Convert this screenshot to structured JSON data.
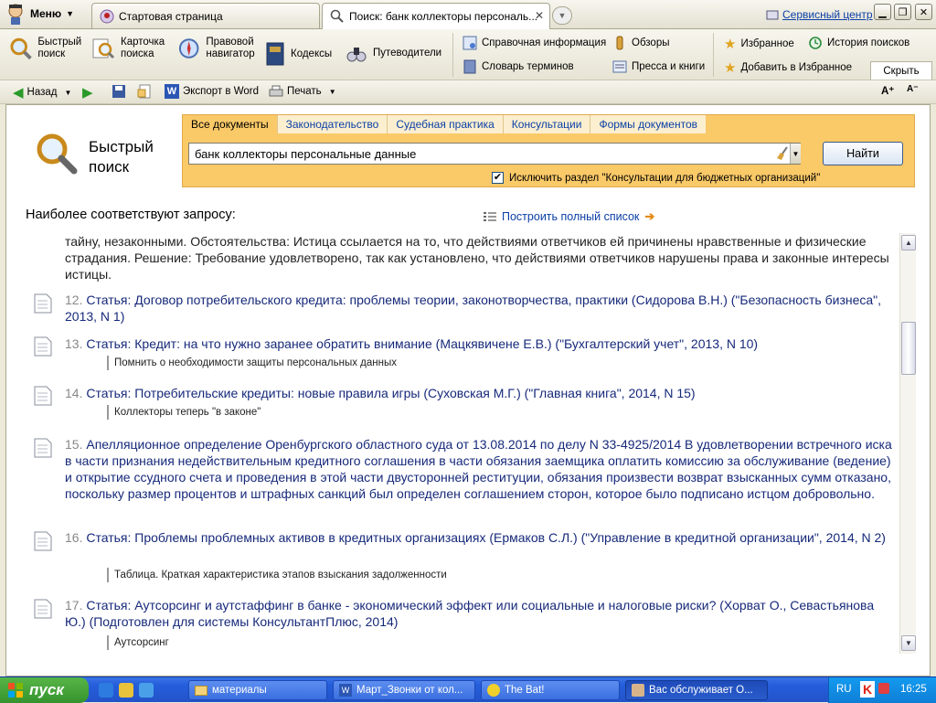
{
  "tabbar": {
    "menu_label": "Меню",
    "tabs": [
      {
        "label": "Стартовая страница"
      },
      {
        "label": "Поиск: банк коллекторы персональ..."
      }
    ],
    "service_link": "Сервисный центр"
  },
  "toolbar": {
    "quick_search": "Быстрый поиск",
    "search_card": "Карточка поиска",
    "legal_navigator": "Правовой навигатор",
    "codes": "Кодексы",
    "guides": "Путеводители",
    "reference_info": "Справочная информация",
    "glossary": "Словарь терминов",
    "reviews": "Обзоры",
    "press_books": "Пресса и книги",
    "favorites": "Избранное",
    "add_favorites": "Добавить в Избранное",
    "search_history": "История поисков",
    "collapse": "Скрыть"
  },
  "toolbar2": {
    "back": "Назад",
    "export_word": "Экспорт в Word",
    "print": "Печать"
  },
  "search_panel": {
    "title": "Быстрый поиск",
    "tabs": [
      "Все документы",
      "Законодательство",
      "Судебная практика",
      "Консультации",
      "Формы документов"
    ],
    "query": "банк коллекторы персональные данные",
    "find_button": "Найти",
    "exclude_label": "Исключить раздел \"Консультации для бюджетных организаций\"",
    "exclude_checked": true
  },
  "results_heading": "Наиболее соответствуют запросу:",
  "build_list_link": "Построить полный список",
  "results": {
    "cut_paragraph": "тайну, незаконными. Обстоятельства: Истица ссылается на то, что действиями ответчиков ей причинены нравственные и физические страдания. Решение: Требование удовлетворено, так как установлено, что действиями ответчиков нарушены права и законные интересы истицы.",
    "items": [
      {
        "num": "12.",
        "text": "Статья: Договор потребительского кредита: проблемы теории, законотворчества, практики (Сидорова В.Н.) (\"Безопасность бизнеса\", 2013, N 1)",
        "snippet": ""
      },
      {
        "num": "13.",
        "text": "Статья: Кредит: на что нужно заранее обратить внимание (Мацкявичене Е.В.) (\"Бухгалтерский учет\", 2013, N 10)",
        "snippet": "Помнить о необходимости защиты персональных данных"
      },
      {
        "num": "14.",
        "text": "Статья: Потребительские кредиты: новые правила игры (Суховская М.Г.) (\"Главная книга\", 2014, N 15)",
        "snippet": "Коллекторы теперь \"в законе\""
      },
      {
        "num": "15.",
        "text": "Апелляционное определение Оренбургского областного суда от 13.08.2014 по делу N 33-4925/2014 В удовлетворении встречного иска в части признания недействительным кредитного соглашения в части обязания заемщика оплатить комиссию за обслуживание (ведение) и открытие ссудного счета и проведения в этой части двусторонней реституции, обязания произвести возврат взысканных сумм отказано, поскольку размер процентов и штрафных санкций был определен соглашением сторон, которое было подписано истцом добровольно.",
        "snippet": ""
      },
      {
        "num": "16.",
        "text": "Статья: Проблемы проблемных активов в кредитных организациях (Ермаков С.Л.) (\"Управление в кредитной организации\", 2014, N 2)",
        "snippet": "Таблица. Краткая характеристика этапов взыскания задолженности"
      },
      {
        "num": "17.",
        "text": "Статья: Аутсорсинг и аутстаффинг в банке - экономический эффект или социальные и налоговые риски? (Хорват О., Севастьянова Ю.) (Подготовлен для системы КонсультантПлюс, 2014)",
        "snippet": "Аутсорсинг"
      }
    ]
  },
  "taskbar": {
    "start": "пуск",
    "tasks": [
      "материалы",
      "Март_Звонки от кол...",
      "The Bat!",
      "Вас обслуживает О..."
    ],
    "lang": "RU",
    "clock": "16:25"
  },
  "colors": {
    "search_box": "#fac968",
    "link": "#0b3fa6",
    "taskbar": "#245edb"
  }
}
